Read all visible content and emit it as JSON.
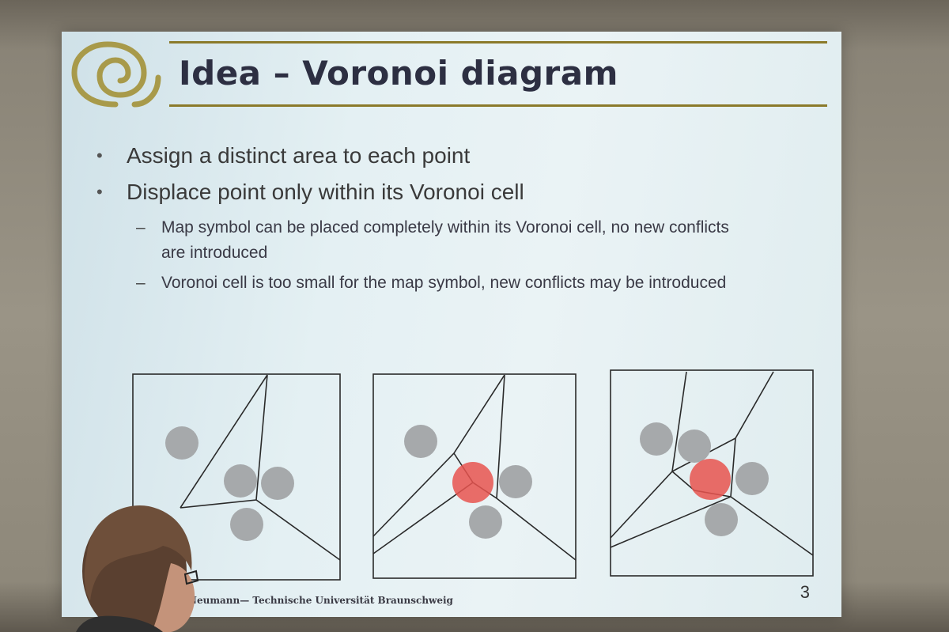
{
  "slide": {
    "title": "Idea – Voronoi diagram",
    "bullets": [
      "Assign a distinct area to each point",
      "Displace point only within its Voronoi cell"
    ],
    "sub_bullets": [
      " Map symbol can be placed completely within its Voronoi cell, no new conflicts are introduced",
      "Voronoi cell is too small for the map symbol, new conflicts may be introduced"
    ],
    "footer": "Neumann— Technische Universität Braunschweig",
    "page_number": "3"
  },
  "colors": {
    "title": "#2d2f42",
    "rule": "#8b7a2a",
    "point_grey": "#a6a9ab",
    "point_red": "#e8534f",
    "logo": "#a89a4a"
  },
  "icons": {
    "logo": "spiral-logo-icon"
  }
}
